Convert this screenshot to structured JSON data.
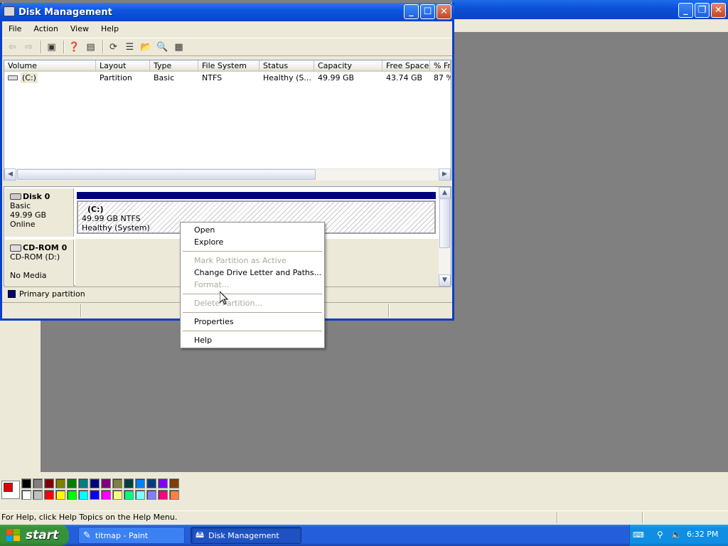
{
  "disk_management": {
    "title": "Disk Management",
    "menu": [
      "File",
      "Action",
      "View",
      "Help"
    ],
    "columns": [
      "Volume",
      "Layout",
      "Type",
      "File System",
      "Status",
      "Capacity",
      "Free Space",
      "% Fr"
    ],
    "rows": [
      {
        "volume": "(C:)",
        "layout": "Partition",
        "type": "Basic",
        "fs": "NTFS",
        "status": "Healthy (S...",
        "capacity": "49.99 GB",
        "free": "43.74 GB",
        "pct": "87 %"
      }
    ],
    "disks": {
      "disk0": {
        "name": "Disk 0",
        "type": "Basic",
        "size": "49.99 GB",
        "state": "Online",
        "partition": {
          "name": "(C:)",
          "detail": "49.99 GB NTFS",
          "status": "Healthy (System)"
        }
      },
      "cdrom0": {
        "name": "CD-ROM 0",
        "drive": "CD-ROM (D:)",
        "media": "No Media"
      }
    },
    "legend": "Primary partition"
  },
  "context_menu": {
    "open": "Open",
    "explore": "Explore",
    "mark_active": "Mark Partition as Active",
    "change_letter": "Change Drive Letter and Paths...",
    "format": "Format...",
    "delete": "Delete Partition...",
    "properties": "Properties",
    "help": "Help"
  },
  "paint": {
    "status": "For Help, click Help Topics on the Help Menu.",
    "palette_top": [
      "#000000",
      "#808080",
      "#800000",
      "#808000",
      "#008000",
      "#008080",
      "#000080",
      "#800080",
      "#808040",
      "#004040",
      "#0080ff",
      "#004080",
      "#8000ff",
      "#804000"
    ],
    "palette_bottom": [
      "#ffffff",
      "#c0c0c0",
      "#ff0000",
      "#ffff00",
      "#00ff00",
      "#00ffff",
      "#0000ff",
      "#ff00ff",
      "#ffff80",
      "#00ff80",
      "#80ffff",
      "#8080ff",
      "#ff0080",
      "#ff8040"
    ]
  },
  "taskbar": {
    "start": "start",
    "items": [
      "titmap - Paint",
      "Disk Management"
    ],
    "clock": "6:32 PM"
  },
  "colors": {
    "xp_blue": "#0a48cd",
    "start_green": "#37913a",
    "disk_bar": "#00007f"
  }
}
